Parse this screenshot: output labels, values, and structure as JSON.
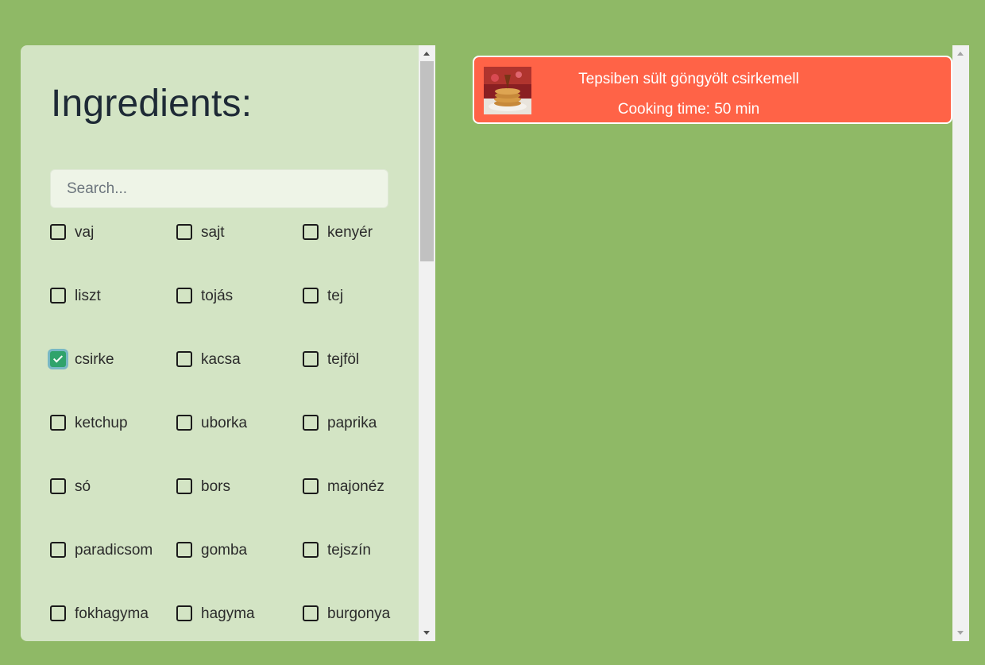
{
  "ingredients_panel": {
    "title": "Ingredients:",
    "search_placeholder": "Search...",
    "items": [
      {
        "label": "vaj",
        "checked": false
      },
      {
        "label": "sajt",
        "checked": false
      },
      {
        "label": "kenyér",
        "checked": false
      },
      {
        "label": "liszt",
        "checked": false
      },
      {
        "label": "tojás",
        "checked": false
      },
      {
        "label": "tej",
        "checked": false
      },
      {
        "label": "csirke",
        "checked": true
      },
      {
        "label": "kacsa",
        "checked": false
      },
      {
        "label": "tejföl",
        "checked": false
      },
      {
        "label": "ketchup",
        "checked": false
      },
      {
        "label": "uborka",
        "checked": false
      },
      {
        "label": "paprika",
        "checked": false
      },
      {
        "label": "só",
        "checked": false
      },
      {
        "label": "bors",
        "checked": false
      },
      {
        "label": "majonéz",
        "checked": false
      },
      {
        "label": "paradicsom",
        "checked": false
      },
      {
        "label": "gomba",
        "checked": false
      },
      {
        "label": "tejszín",
        "checked": false
      },
      {
        "label": "fokhagyma",
        "checked": false
      },
      {
        "label": "hagyma",
        "checked": false
      },
      {
        "label": "burgonya",
        "checked": false
      }
    ]
  },
  "recipes": [
    {
      "title": "Tepsiben sült göngyölt csirkemell",
      "cooking_time": "Cooking time: 50 min",
      "image": "pancake-stack-photo"
    }
  ],
  "colors": {
    "background": "#8fb966",
    "panel": "#d3e4c4",
    "recipe_card": "#ff6347",
    "checkbox_checked": "#2fa36b"
  }
}
